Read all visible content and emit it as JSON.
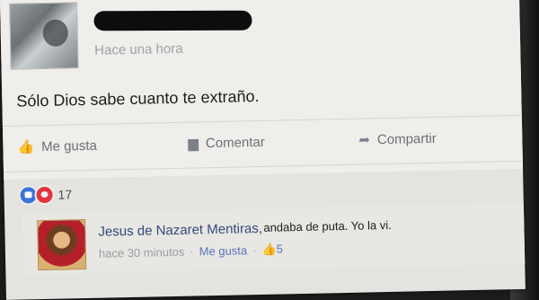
{
  "post": {
    "time": "Hace una hora",
    "text": "Sólo Dios sabe cuanto te extraño."
  },
  "actions": {
    "like": "Me gusta",
    "comment": "Comentar",
    "share": "Compartir"
  },
  "reactions": {
    "count": "17"
  },
  "comment": {
    "author": "Jesus de Nazaret Mentiras,",
    "text": "andaba de puta. Yo la vi.",
    "time": "hace 30 minutos",
    "like_label": "Me gusta",
    "like_count": "5",
    "separator": "·"
  },
  "icons": {
    "like": "thumbs-up-icon",
    "comment": "speech-bubble-icon",
    "share": "share-arrow-icon"
  },
  "colors": {
    "link": "#344a7e",
    "like_reaction": "#3b73d9",
    "love_reaction": "#e2333f"
  }
}
